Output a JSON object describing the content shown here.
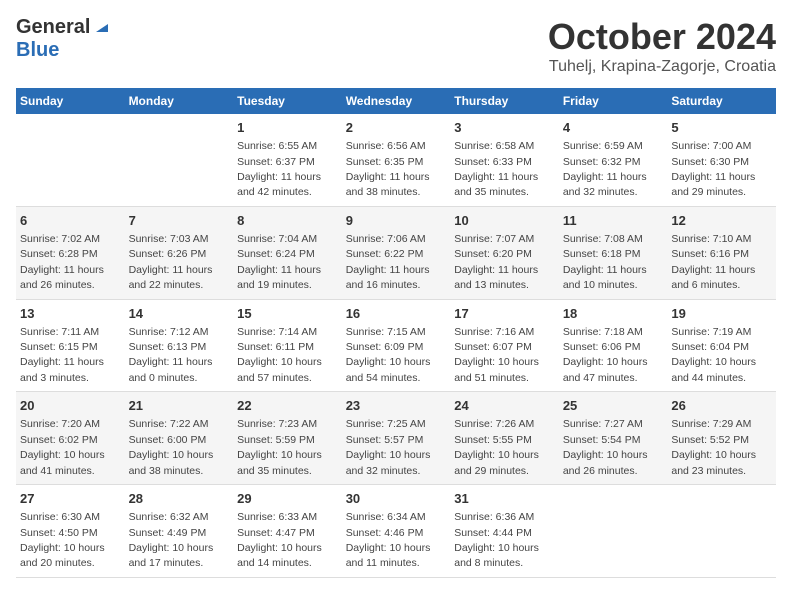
{
  "logo": {
    "line1": "General",
    "line2": "Blue",
    "icon": "▶"
  },
  "header": {
    "month": "October 2024",
    "location": "Tuhelj, Krapina-Zagorje, Croatia"
  },
  "weekdays": [
    "Sunday",
    "Monday",
    "Tuesday",
    "Wednesday",
    "Thursday",
    "Friday",
    "Saturday"
  ],
  "weeks": [
    [
      {
        "day": "",
        "info": ""
      },
      {
        "day": "",
        "info": ""
      },
      {
        "day": "1",
        "info": "Sunrise: 6:55 AM\nSunset: 6:37 PM\nDaylight: 11 hours and 42 minutes."
      },
      {
        "day": "2",
        "info": "Sunrise: 6:56 AM\nSunset: 6:35 PM\nDaylight: 11 hours and 38 minutes."
      },
      {
        "day": "3",
        "info": "Sunrise: 6:58 AM\nSunset: 6:33 PM\nDaylight: 11 hours and 35 minutes."
      },
      {
        "day": "4",
        "info": "Sunrise: 6:59 AM\nSunset: 6:32 PM\nDaylight: 11 hours and 32 minutes."
      },
      {
        "day": "5",
        "info": "Sunrise: 7:00 AM\nSunset: 6:30 PM\nDaylight: 11 hours and 29 minutes."
      }
    ],
    [
      {
        "day": "6",
        "info": "Sunrise: 7:02 AM\nSunset: 6:28 PM\nDaylight: 11 hours and 26 minutes."
      },
      {
        "day": "7",
        "info": "Sunrise: 7:03 AM\nSunset: 6:26 PM\nDaylight: 11 hours and 22 minutes."
      },
      {
        "day": "8",
        "info": "Sunrise: 7:04 AM\nSunset: 6:24 PM\nDaylight: 11 hours and 19 minutes."
      },
      {
        "day": "9",
        "info": "Sunrise: 7:06 AM\nSunset: 6:22 PM\nDaylight: 11 hours and 16 minutes."
      },
      {
        "day": "10",
        "info": "Sunrise: 7:07 AM\nSunset: 6:20 PM\nDaylight: 11 hours and 13 minutes."
      },
      {
        "day": "11",
        "info": "Sunrise: 7:08 AM\nSunset: 6:18 PM\nDaylight: 11 hours and 10 minutes."
      },
      {
        "day": "12",
        "info": "Sunrise: 7:10 AM\nSunset: 6:16 PM\nDaylight: 11 hours and 6 minutes."
      }
    ],
    [
      {
        "day": "13",
        "info": "Sunrise: 7:11 AM\nSunset: 6:15 PM\nDaylight: 11 hours and 3 minutes."
      },
      {
        "day": "14",
        "info": "Sunrise: 7:12 AM\nSunset: 6:13 PM\nDaylight: 11 hours and 0 minutes."
      },
      {
        "day": "15",
        "info": "Sunrise: 7:14 AM\nSunset: 6:11 PM\nDaylight: 10 hours and 57 minutes."
      },
      {
        "day": "16",
        "info": "Sunrise: 7:15 AM\nSunset: 6:09 PM\nDaylight: 10 hours and 54 minutes."
      },
      {
        "day": "17",
        "info": "Sunrise: 7:16 AM\nSunset: 6:07 PM\nDaylight: 10 hours and 51 minutes."
      },
      {
        "day": "18",
        "info": "Sunrise: 7:18 AM\nSunset: 6:06 PM\nDaylight: 10 hours and 47 minutes."
      },
      {
        "day": "19",
        "info": "Sunrise: 7:19 AM\nSunset: 6:04 PM\nDaylight: 10 hours and 44 minutes."
      }
    ],
    [
      {
        "day": "20",
        "info": "Sunrise: 7:20 AM\nSunset: 6:02 PM\nDaylight: 10 hours and 41 minutes."
      },
      {
        "day": "21",
        "info": "Sunrise: 7:22 AM\nSunset: 6:00 PM\nDaylight: 10 hours and 38 minutes."
      },
      {
        "day": "22",
        "info": "Sunrise: 7:23 AM\nSunset: 5:59 PM\nDaylight: 10 hours and 35 minutes."
      },
      {
        "day": "23",
        "info": "Sunrise: 7:25 AM\nSunset: 5:57 PM\nDaylight: 10 hours and 32 minutes."
      },
      {
        "day": "24",
        "info": "Sunrise: 7:26 AM\nSunset: 5:55 PM\nDaylight: 10 hours and 29 minutes."
      },
      {
        "day": "25",
        "info": "Sunrise: 7:27 AM\nSunset: 5:54 PM\nDaylight: 10 hours and 26 minutes."
      },
      {
        "day": "26",
        "info": "Sunrise: 7:29 AM\nSunset: 5:52 PM\nDaylight: 10 hours and 23 minutes."
      }
    ],
    [
      {
        "day": "27",
        "info": "Sunrise: 6:30 AM\nSunset: 4:50 PM\nDaylight: 10 hours and 20 minutes."
      },
      {
        "day": "28",
        "info": "Sunrise: 6:32 AM\nSunset: 4:49 PM\nDaylight: 10 hours and 17 minutes."
      },
      {
        "day": "29",
        "info": "Sunrise: 6:33 AM\nSunset: 4:47 PM\nDaylight: 10 hours and 14 minutes."
      },
      {
        "day": "30",
        "info": "Sunrise: 6:34 AM\nSunset: 4:46 PM\nDaylight: 10 hours and 11 minutes."
      },
      {
        "day": "31",
        "info": "Sunrise: 6:36 AM\nSunset: 4:44 PM\nDaylight: 10 hours and 8 minutes."
      },
      {
        "day": "",
        "info": ""
      },
      {
        "day": "",
        "info": ""
      }
    ]
  ]
}
